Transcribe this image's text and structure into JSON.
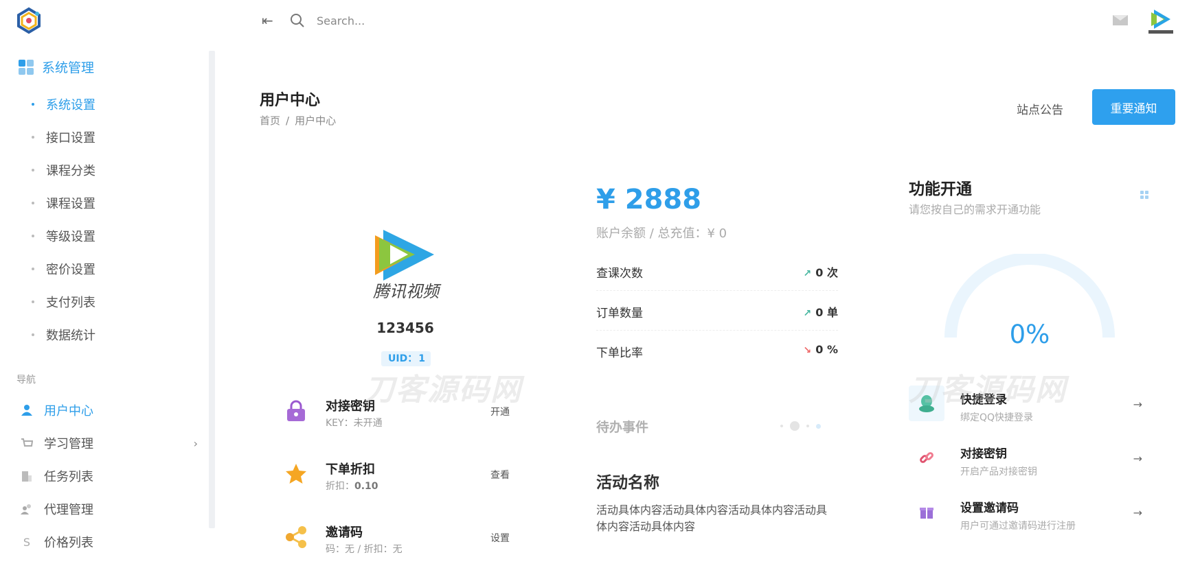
{
  "sidebar": {
    "group_label": "系统管理",
    "sub_items": [
      {
        "label": "系统设置",
        "active": true
      },
      {
        "label": "接口设置",
        "active": false
      },
      {
        "label": "课程分类",
        "active": false
      },
      {
        "label": "课程设置",
        "active": false
      },
      {
        "label": "等级设置",
        "active": false
      },
      {
        "label": "密价设置",
        "active": false
      },
      {
        "label": "支付列表",
        "active": false
      },
      {
        "label": "数据统计",
        "active": false
      }
    ],
    "nav_caption": "导航",
    "nav_items": [
      {
        "label": "用户中心",
        "icon": "user-icon",
        "active": true
      },
      {
        "label": "学习管理",
        "icon": "cart-icon",
        "has_children": true
      },
      {
        "label": "任务列表",
        "icon": "building-icon"
      },
      {
        "label": "代理管理",
        "icon": "users-icon"
      },
      {
        "label": "价格列表",
        "icon": "dollar-icon",
        "glyph": "S"
      }
    ]
  },
  "topbar": {
    "search_placeholder": "Search..."
  },
  "page": {
    "title": "用户中心",
    "breadcrumb": [
      "首页",
      "用户中心"
    ],
    "breadcrumb_sep": "/",
    "notice_link": "站点公告",
    "notice_button": "重要通知"
  },
  "user": {
    "name": "123456",
    "uid_label": "UID：",
    "uid": "1",
    "logo_text": "腾讯视频"
  },
  "features": [
    {
      "title": "对接密钥",
      "sub_label": "KEY：",
      "sub_value": "未开通",
      "action": "开通",
      "icon": "lock-icon"
    },
    {
      "title": "下单折扣",
      "sub_label": "折扣：",
      "sub_value": "0.10",
      "action": "查看",
      "icon": "star-icon"
    },
    {
      "title": "邀请码",
      "sub_label": "码：",
      "sub_value": "无 / 折扣：无",
      "action": "设置",
      "icon": "share-icon"
    }
  ],
  "account": {
    "balance": "¥ 2888",
    "balance_sub": "账户余额 / 总充值：¥ 0"
  },
  "stats": [
    {
      "label": "查课次数",
      "value": "0 次",
      "trend": "up"
    },
    {
      "label": "订单数量",
      "value": "0 单",
      "trend": "up"
    },
    {
      "label": "下单比率",
      "value": "0 %",
      "trend": "down"
    }
  ],
  "todo": {
    "title": "待办事件"
  },
  "activity": {
    "title": "活动名称",
    "content": "活动具体内容活动具体内容活动具体内容活动具体内容活动具体内容"
  },
  "functions": {
    "title": "功能开通",
    "subtitle": "请您按自己的需求开通功能",
    "progress_text": "0%",
    "progress": 0,
    "items": [
      {
        "title": "快捷登录",
        "sub": "绑定QQ快捷登录",
        "icon": "qq-icon"
      },
      {
        "title": "对接密钥",
        "sub": "开启产品对接密钥",
        "icon": "link-icon"
      },
      {
        "title": "设置邀请码",
        "sub": "用户可通过邀请码进行注册",
        "icon": "gift-icon"
      }
    ]
  },
  "watermark": "刀客源码网",
  "colors": {
    "accent": "#2e9ee9",
    "button": "#2ea0ee",
    "trend_up": "#47b7a0",
    "trend_down": "#e66666"
  }
}
